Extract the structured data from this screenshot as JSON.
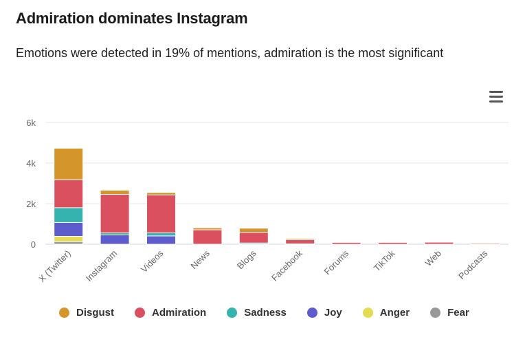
{
  "header": {
    "title": "Admiration dominates Instagram",
    "subtitle": "Emotions were detected in 19% of mentions, admiration is the most significant"
  },
  "menu_icon": "hamburger-menu-icon",
  "chart_data": {
    "type": "bar",
    "stacked": true,
    "title": "Admiration dominates Instagram",
    "xlabel": "",
    "ylabel": "",
    "ylim": [
      0,
      6000
    ],
    "yticks": [
      0,
      2000,
      4000,
      6000
    ],
    "ytick_labels": [
      "0",
      "2k",
      "4k",
      "6k"
    ],
    "grid": true,
    "legend_position": "bottom",
    "categories": [
      "X (Twitter)",
      "Instagram",
      "Videos",
      "News",
      "Blogs",
      "Facebook",
      "Forums",
      "TikTok",
      "Web",
      "Podcasts"
    ],
    "series": [
      {
        "name": "Disgust",
        "color": "#d4962a",
        "values": [
          1550,
          200,
          120,
          100,
          200,
          60,
          0,
          0,
          0,
          0
        ]
      },
      {
        "name": "Admiration",
        "color": "#db505f",
        "values": [
          1380,
          1900,
          1870,
          710,
          530,
          200,
          90,
          90,
          100,
          50
        ]
      },
      {
        "name": "Sadness",
        "color": "#35b3ae",
        "values": [
          730,
          100,
          150,
          0,
          60,
          20,
          0,
          0,
          0,
          0
        ]
      },
      {
        "name": "Joy",
        "color": "#5e5ccc",
        "values": [
          680,
          460,
          410,
          0,
          0,
          0,
          0,
          0,
          0,
          0
        ]
      },
      {
        "name": "Anger",
        "color": "#e3dc52",
        "values": [
          260,
          0,
          0,
          0,
          0,
          0,
          0,
          0,
          0,
          0
        ]
      },
      {
        "name": "Fear",
        "color": "#999999",
        "values": [
          130,
          0,
          0,
          0,
          0,
          0,
          0,
          0,
          0,
          0
        ]
      }
    ]
  }
}
